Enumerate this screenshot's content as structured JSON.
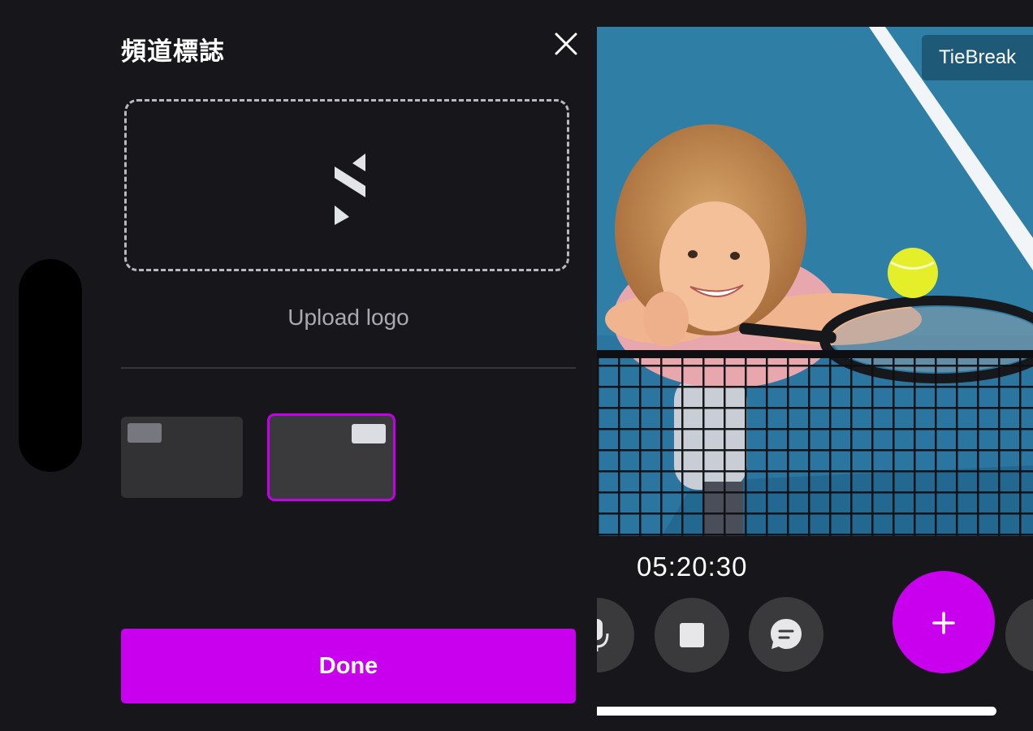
{
  "panel": {
    "title": "頻道標誌",
    "close_icon": "close-icon",
    "upload_label": "Upload logo",
    "logo_icon": "logo-s-icon",
    "position_options": [
      {
        "label": "top-left",
        "selected": false
      },
      {
        "label": "top-right",
        "selected": true
      }
    ],
    "done_label": "Done"
  },
  "preview": {
    "channel_name": "TieBreak",
    "image_subject": "child on tennis court leaning over net with racket and ball"
  },
  "controls": {
    "timer": "05:20:30",
    "buttons": [
      "microphone-icon",
      "stop-icon",
      "chat-icon",
      "plus-icon"
    ]
  },
  "colors": {
    "background": "#17171b",
    "accent": "#c800ee",
    "control_bg": "#3a3a3d",
    "court": "#2f7fa8"
  }
}
